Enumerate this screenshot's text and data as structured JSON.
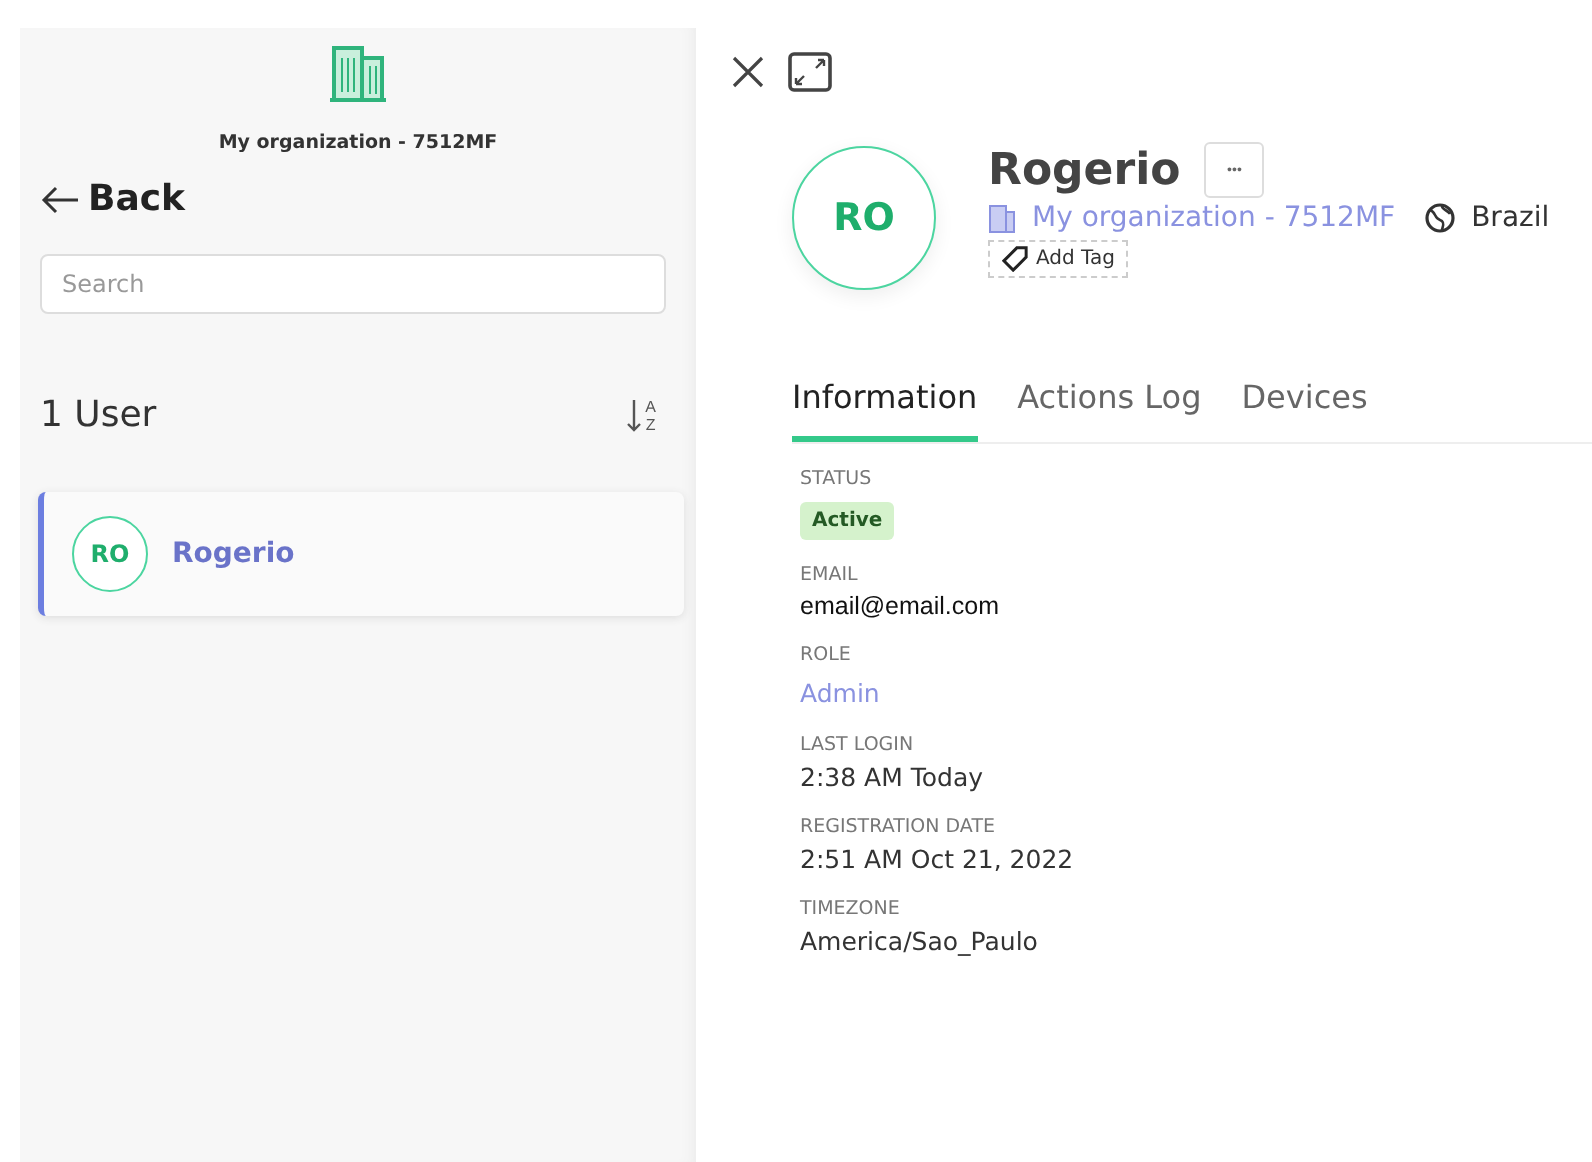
{
  "sidebar": {
    "organization": "My organization - 7512MF",
    "back": "Back",
    "search": {
      "placeholder": "Search"
    },
    "count_label": "1 User",
    "sort_letters": [
      "A",
      "Z"
    ],
    "users": [
      {
        "initials": "RO",
        "name": "Rogerio",
        "selected": true
      }
    ]
  },
  "panel": {
    "initials": "RO",
    "name": "Rogerio",
    "more": "•••",
    "organization": "My organization - 7512MF",
    "country": "Brazil",
    "add_tag": "Add Tag",
    "tabs": [
      {
        "label": "Information",
        "selected": true
      },
      {
        "label": "Actions Log",
        "selected": false
      },
      {
        "label": "Devices",
        "selected": false
      }
    ],
    "fields": [
      {
        "label": "STATUS",
        "value": "Active",
        "kind": "badge"
      },
      {
        "label": "EMAIL",
        "value": "email@email.com",
        "kind": "plain"
      },
      {
        "label": "ROLE",
        "value": "Admin",
        "kind": "link"
      },
      {
        "label": "LAST LOGIN",
        "value": "2:38 AM Today",
        "kind": "text"
      },
      {
        "label": "REGISTRATION DATE",
        "value": "2:51 AM Oct 21, 2022",
        "kind": "text"
      },
      {
        "label": "TIMEZONE",
        "value": "America/Sao_Paulo",
        "kind": "text"
      }
    ]
  }
}
